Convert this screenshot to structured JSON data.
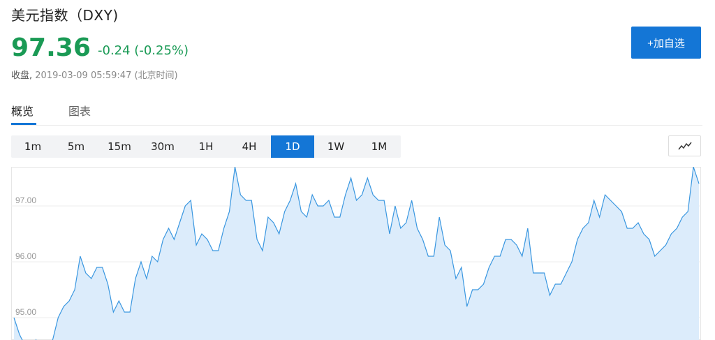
{
  "header": {
    "title": "美元指数（DXY)",
    "price": "97.36",
    "change": "-0.24 (-0.25%)",
    "close_label": "收盘,",
    "timestamp": "2019-03-09 05:59:47 (北京时间)"
  },
  "actions": {
    "add_watchlist_label": "+加自选"
  },
  "tabs": [
    {
      "label": "概览",
      "active": true
    },
    {
      "label": "图表",
      "active": false
    }
  ],
  "intervals": [
    {
      "label": "1m",
      "active": false
    },
    {
      "label": "5m",
      "active": false
    },
    {
      "label": "15m",
      "active": false
    },
    {
      "label": "30m",
      "active": false
    },
    {
      "label": "1H",
      "active": false
    },
    {
      "label": "4H",
      "active": false
    },
    {
      "label": "1D",
      "active": true
    },
    {
      "label": "1W",
      "active": false
    },
    {
      "label": "1M",
      "active": false
    }
  ],
  "chart_type_icon": "line-chart-icon",
  "colors": {
    "accent": "#1476d6",
    "positive": "#1a9a55",
    "line": "#3a97e0",
    "area": "#dcecfb"
  },
  "chart_data": {
    "type": "area",
    "ylim": [
      94.6,
      97.7
    ],
    "yticks": [
      "97.00",
      "96.00",
      "95.00"
    ],
    "ytick_values": [
      97.0,
      96.0,
      95.0
    ],
    "grid": true,
    "values": [
      95.0,
      94.7,
      94.5,
      94.3,
      94.6,
      94.3,
      94.4,
      94.6,
      95.0,
      95.2,
      95.3,
      95.5,
      96.1,
      95.8,
      95.7,
      95.9,
      95.9,
      95.6,
      95.1,
      95.3,
      95.1,
      95.1,
      95.7,
      96.0,
      95.7,
      96.1,
      96.0,
      96.4,
      96.6,
      96.4,
      96.7,
      97.0,
      97.1,
      96.3,
      96.5,
      96.4,
      96.2,
      96.2,
      96.6,
      96.9,
      97.7,
      97.2,
      97.1,
      97.1,
      96.4,
      96.2,
      96.8,
      96.7,
      96.5,
      96.9,
      97.1,
      97.4,
      96.9,
      96.8,
      97.2,
      97.0,
      97.0,
      97.1,
      96.8,
      96.8,
      97.2,
      97.5,
      97.1,
      97.2,
      97.5,
      97.2,
      97.1,
      97.1,
      96.5,
      97.0,
      96.6,
      96.7,
      97.1,
      96.6,
      96.4,
      96.1,
      96.1,
      96.8,
      96.3,
      96.2,
      95.7,
      95.9,
      95.2,
      95.5,
      95.5,
      95.6,
      95.9,
      96.1,
      96.1,
      96.4,
      96.4,
      96.3,
      96.1,
      96.6,
      95.8,
      95.8,
      95.8,
      95.4,
      95.6,
      95.6,
      95.8,
      96.0,
      96.4,
      96.6,
      96.7,
      97.1,
      96.8,
      97.2,
      97.1,
      97.0,
      96.9,
      96.6,
      96.6,
      96.7,
      96.5,
      96.4,
      96.1,
      96.2,
      96.3,
      96.5,
      96.6,
      96.8,
      96.9,
      97.7,
      97.4
    ]
  }
}
